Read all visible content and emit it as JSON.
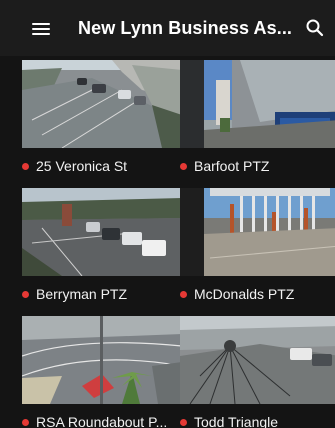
{
  "appbar": {
    "title": "New Lynn Business As...",
    "menu_icon": "hamburger-menu-icon",
    "search_icon": "search-icon"
  },
  "status_color": "#e53935",
  "cameras": [
    {
      "label": "25 Veronica St"
    },
    {
      "label": "Barfoot PTZ"
    },
    {
      "label": "Berryman PTZ"
    },
    {
      "label": "McDonalds PTZ"
    },
    {
      "label": "RSA Roundabout P..."
    },
    {
      "label": "Todd Triangle"
    }
  ]
}
